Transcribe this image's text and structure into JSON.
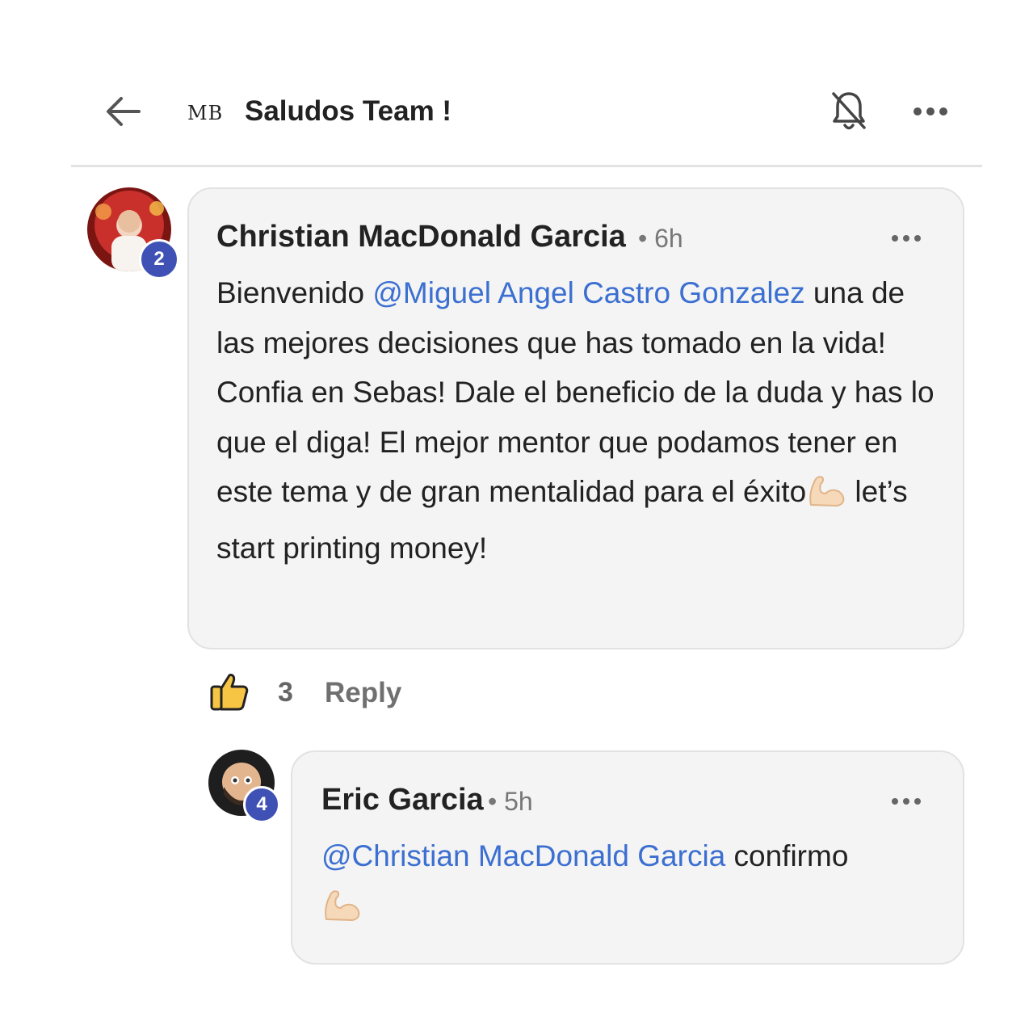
{
  "header": {
    "back_icon": "arrow-left-icon",
    "group_logo": "MB",
    "title": "Saludos Team !",
    "notification_icon": "bell-off-icon",
    "more_icon": "more-horizontal-icon"
  },
  "comments": [
    {
      "author": "Christian MacDonald Garcia",
      "time": "6h",
      "separator": "•",
      "badge": "2",
      "text_before_mention": "Bienvenido ",
      "mention": "@Miguel Angel Castro Gonzalez",
      "text_after_mention": " una de las mejores decisiones que has tomado en la vida! Confia en Sebas! Dale el beneficio de la duda y has lo que el diga! El mejor mentor que podamos tener en este tema y de gran mentalidad para el éxito",
      "emoji": "flexed-biceps-emoji",
      "text_after_emoji": " let’s start printing money!",
      "likes": "3",
      "reply_label": "Reply",
      "like_icon": "thumbs-up-icon"
    },
    {
      "author": "Eric Garcia",
      "time": "5h",
      "separator": "•",
      "badge": "4",
      "mention": "@Christian MacDonald Garcia",
      "text_after_mention": " confirmo",
      "emoji": "flexed-biceps-emoji"
    }
  ],
  "colors": {
    "mention": "#3b6fd1",
    "badge": "#3f51b5",
    "bubble": "#f4f4f4"
  }
}
